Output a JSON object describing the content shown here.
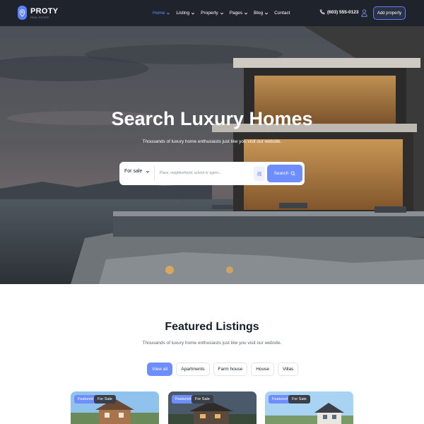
{
  "brand": {
    "name": "PROTY",
    "tagline": "REAL ESTATE"
  },
  "nav": [
    {
      "label": "Home",
      "active": true,
      "dropdown": true
    },
    {
      "label": "Listing",
      "active": false,
      "dropdown": true
    },
    {
      "label": "Property",
      "active": false,
      "dropdown": true
    },
    {
      "label": "Pages",
      "active": false,
      "dropdown": true
    },
    {
      "label": "Blog",
      "active": false,
      "dropdown": true
    },
    {
      "label": "Contact",
      "active": false,
      "dropdown": false
    }
  ],
  "header": {
    "phone": "(603) 555-0123",
    "add_property": "Add property",
    "user_icon": "user-icon",
    "phone_icon": "phone-icon"
  },
  "hero": {
    "title": "Search Luxury Homes",
    "subtitle": "Thousands of luxury home enthusiasts just like you visit our website."
  },
  "search": {
    "type_value": "For sale",
    "placeholder": "Place, neighborhood, school or agent...",
    "button": "Search"
  },
  "featured": {
    "title": "Featured Listings",
    "subtitle": "Thousands of luxury home enthusiasts just like you visit our website.",
    "tabs": [
      "View all",
      "Apartments",
      "Farm house",
      "House",
      "Villas"
    ],
    "active_tab": "View all",
    "cards": [
      {
        "badge_featured": "Featured",
        "badge_status": "For Sale"
      },
      {
        "badge_featured": "Featured",
        "badge_status": "For Sale"
      },
      {
        "badge_featured": "Featured",
        "badge_status": "For Sale"
      }
    ]
  },
  "colors": {
    "accent": "#6e8dff",
    "header_bg": "#1f232b",
    "text_dark": "#161e2d"
  }
}
